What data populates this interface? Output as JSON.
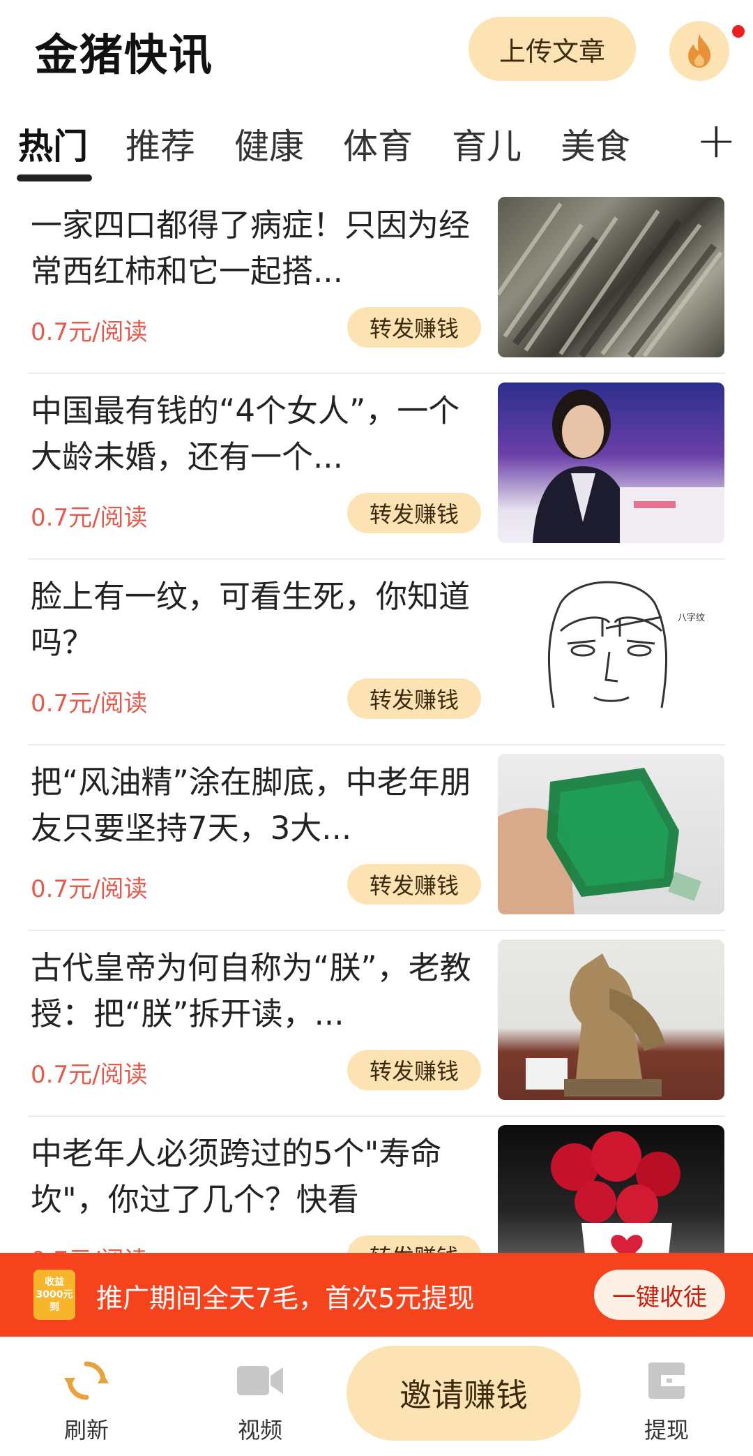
{
  "header": {
    "title": "金猪快讯",
    "upload_label": "上传文章",
    "fire_icon": "fire-icon"
  },
  "tabs": {
    "items": [
      "热门",
      "推荐",
      "健康",
      "体育",
      "育儿",
      "美食"
    ],
    "active": "热门",
    "add_label": "+"
  },
  "articles": [
    {
      "title": "一家四口都得了病症！只因为经常西红柿和它一起搭...",
      "price": "0.7元/阅读",
      "share_label": "转发赚钱",
      "thumb": "dried-fish"
    },
    {
      "title": "中国最有钱的“4个女人”，一个大龄未婚，还有一个...",
      "price": "0.7元/阅读",
      "share_label": "转发赚钱",
      "thumb": "woman-speaker"
    },
    {
      "title": "脸上有一纹，可看生死，你知道吗？",
      "price": "0.7元/阅读",
      "share_label": "转发赚钱",
      "thumb": "face-sketch",
      "thumb_caption": "八字纹"
    },
    {
      "title": "把“风油精”涂在脚底，中老年朋友只要坚持7天，3大...",
      "price": "0.7元/阅读",
      "share_label": "转发赚钱",
      "thumb": "green-bottle"
    },
    {
      "title": "古代皇帝为何自称为“朕”，老教授：把“朕”拆开读，...",
      "price": "0.7元/阅读",
      "share_label": "转发赚钱",
      "thumb": "statue"
    },
    {
      "title": "中老年人必须跨过的5个\"寿命坎\"，你过了几个？快看",
      "price": "0.7元/阅读",
      "share_label": "转发赚钱",
      "thumb": "roses-cup"
    }
  ],
  "banner": {
    "badge_top": "收益",
    "badge_amount": "3000元",
    "badge_bottom": "到",
    "text": "推广期间全天7毛，首次5元提现",
    "button_label": "一键收徒"
  },
  "bottom_nav": {
    "refresh_label": "刷新",
    "video_label": "视频",
    "invite_label": "邀请赚钱",
    "withdraw_label": "提现"
  },
  "colors": {
    "accent_light": "#fde3b3",
    "price_red": "#e25b4d",
    "banner_red": "#f5431e",
    "refresh_orange": "#e8a33d"
  }
}
